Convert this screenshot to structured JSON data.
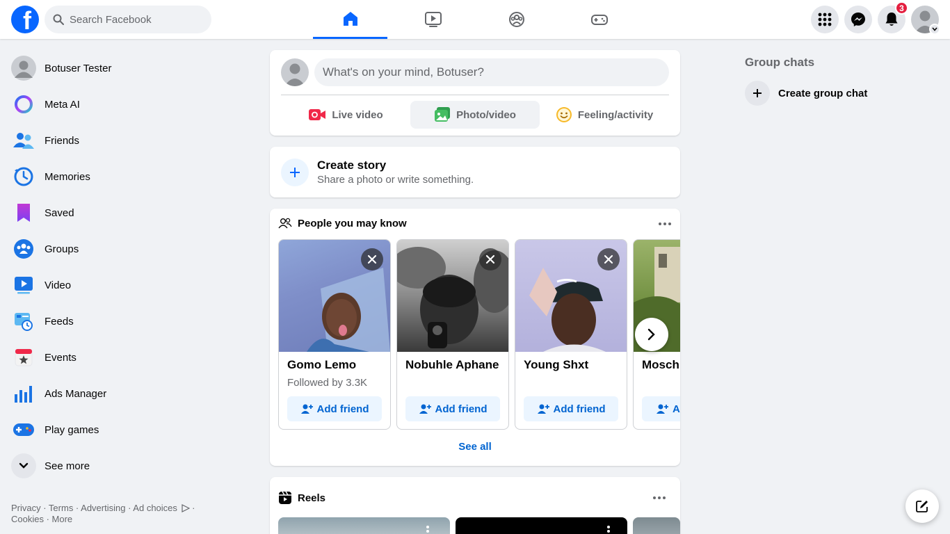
{
  "header": {
    "logo_letter": "f",
    "search_placeholder": "Search Facebook",
    "notification_count": "3",
    "nav_tabs": [
      "home-icon",
      "video-icon",
      "groups-icon",
      "gaming-icon"
    ]
  },
  "sidebar": {
    "items": [
      {
        "label": "Botuser Tester",
        "icon": "profile-avatar"
      },
      {
        "label": "Meta AI",
        "icon": "meta-ai-icon"
      },
      {
        "label": "Friends",
        "icon": "friends-icon"
      },
      {
        "label": "Memories",
        "icon": "memories-icon"
      },
      {
        "label": "Saved",
        "icon": "saved-icon"
      },
      {
        "label": "Groups",
        "icon": "groups-icon"
      },
      {
        "label": "Video",
        "icon": "video-icon"
      },
      {
        "label": "Feeds",
        "icon": "feeds-icon"
      },
      {
        "label": "Events",
        "icon": "events-icon"
      },
      {
        "label": "Ads Manager",
        "icon": "ads-manager-icon"
      },
      {
        "label": "Play games",
        "icon": "play-games-icon"
      },
      {
        "label": "See more",
        "icon": "chevron-down-icon"
      }
    ],
    "footer_line1": "Privacy · Terms · Advertising · Ad choices",
    "footer_dot": " ·",
    "footer_line2": "Cookies · More"
  },
  "composer": {
    "placeholder": "What's on your mind, Botuser?",
    "live_video": "Live video",
    "photo_video": "Photo/video",
    "feeling": "Feeling/activity"
  },
  "story": {
    "title": "Create story",
    "subtitle": "Share a photo or write something."
  },
  "pymk": {
    "title": "People you may know",
    "people": [
      {
        "name": "Gomo Lemo",
        "meta": "Followed by 3.3K",
        "button": "Add friend"
      },
      {
        "name": "Nobuhle Aphane",
        "meta": "",
        "button": "Add friend"
      },
      {
        "name": "Young Shxt",
        "meta": "",
        "button": "Add friend"
      },
      {
        "name": "Moschi",
        "meta": "",
        "button": "Ac"
      }
    ],
    "see_all": "See all"
  },
  "reels": {
    "title": "Reels"
  },
  "right": {
    "group_chats_title": "Group chats",
    "create_group_chat": "Create group chat"
  },
  "colors": {
    "brand": "#0866ff",
    "link": "#0064d1",
    "badge": "#e41e3f"
  }
}
